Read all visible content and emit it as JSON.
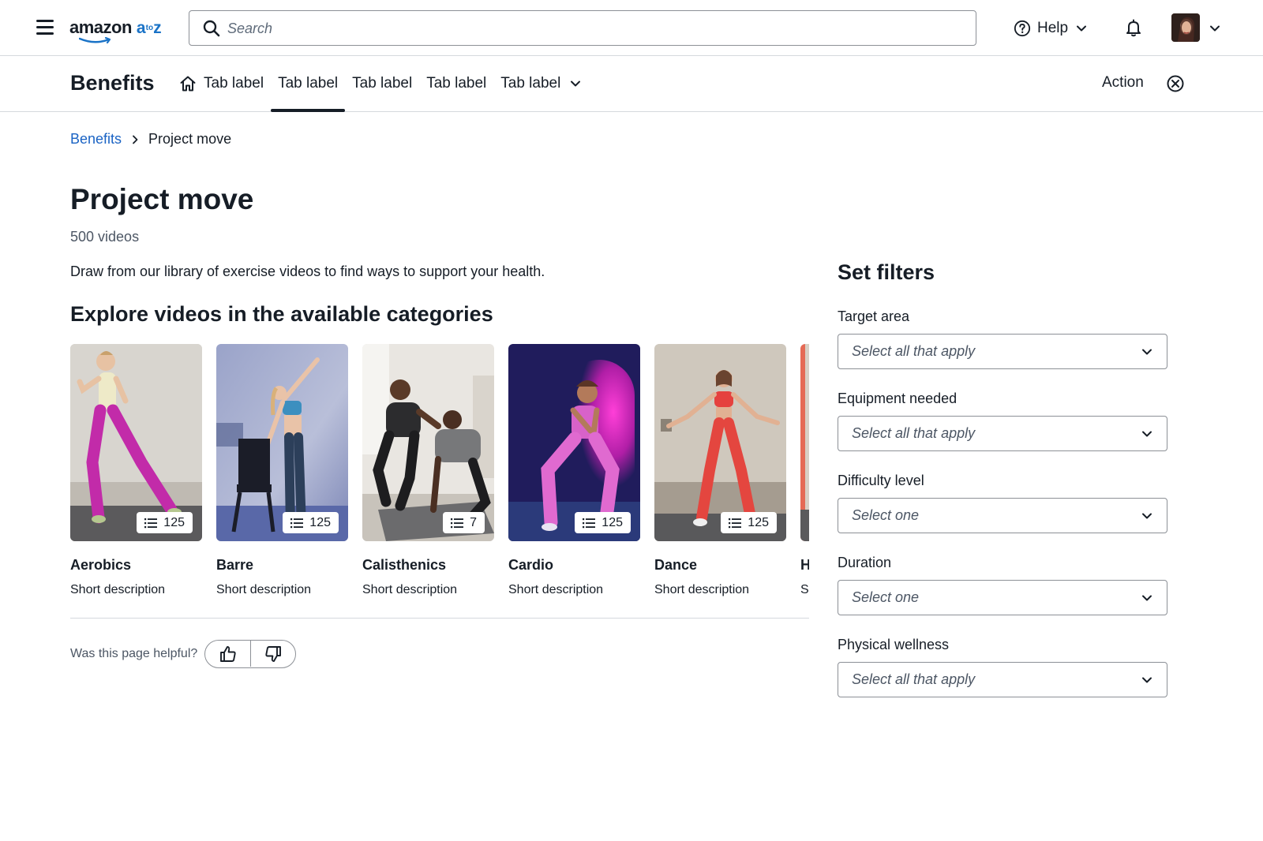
{
  "header": {
    "logo_word": "amazon",
    "logo_a": "a",
    "logo_to": "to",
    "logo_z": "z",
    "search_placeholder": "Search",
    "help_label": "Help"
  },
  "subnav": {
    "title": "Benefits",
    "tabs": [
      {
        "label": "Tab label",
        "icon": "home-icon",
        "active": false
      },
      {
        "label": "Tab label",
        "active": true
      },
      {
        "label": "Tab label",
        "active": false
      },
      {
        "label": "Tab label",
        "active": false
      },
      {
        "label": "Tab label",
        "icon": "chevron-down-icon",
        "active": false
      }
    ],
    "action_label": "Action"
  },
  "breadcrumb": {
    "parent": "Benefits",
    "current": "Project move"
  },
  "page": {
    "title": "Project move",
    "count": "500 videos",
    "description": "Draw from our library of exercise videos to find ways to support your health.",
    "section_title": "Explore videos in the available categories"
  },
  "cards": [
    {
      "name": "Aerobics",
      "description": "Short description",
      "count": "125"
    },
    {
      "name": "Barre",
      "description": "Short description",
      "count": "125"
    },
    {
      "name": "Calisthenics",
      "description": "Short description",
      "count": "7"
    },
    {
      "name": "Cardio",
      "description": "Short description",
      "count": "125"
    },
    {
      "name": "Dance",
      "description": "Short description",
      "count": "125"
    },
    {
      "name": "H",
      "description": "Sh",
      "count": ""
    }
  ],
  "feedback": {
    "question": "Was this page helpful?"
  },
  "filters": {
    "title": "Set filters",
    "items": [
      {
        "label": "Target area",
        "placeholder": "Select all that apply"
      },
      {
        "label": "Equipment needed",
        "placeholder": "Select all that apply"
      },
      {
        "label": "Difficulty level",
        "placeholder": "Select one"
      },
      {
        "label": "Duration",
        "placeholder": "Select one"
      },
      {
        "label": "Physical wellness",
        "placeholder": "Select all that apply"
      }
    ]
  },
  "colors": {
    "text": "#161d26",
    "link": "#1a63c4",
    "brand_accent": "#1a73c7",
    "border": "#8c9096",
    "divider": "#d5d9dd"
  }
}
